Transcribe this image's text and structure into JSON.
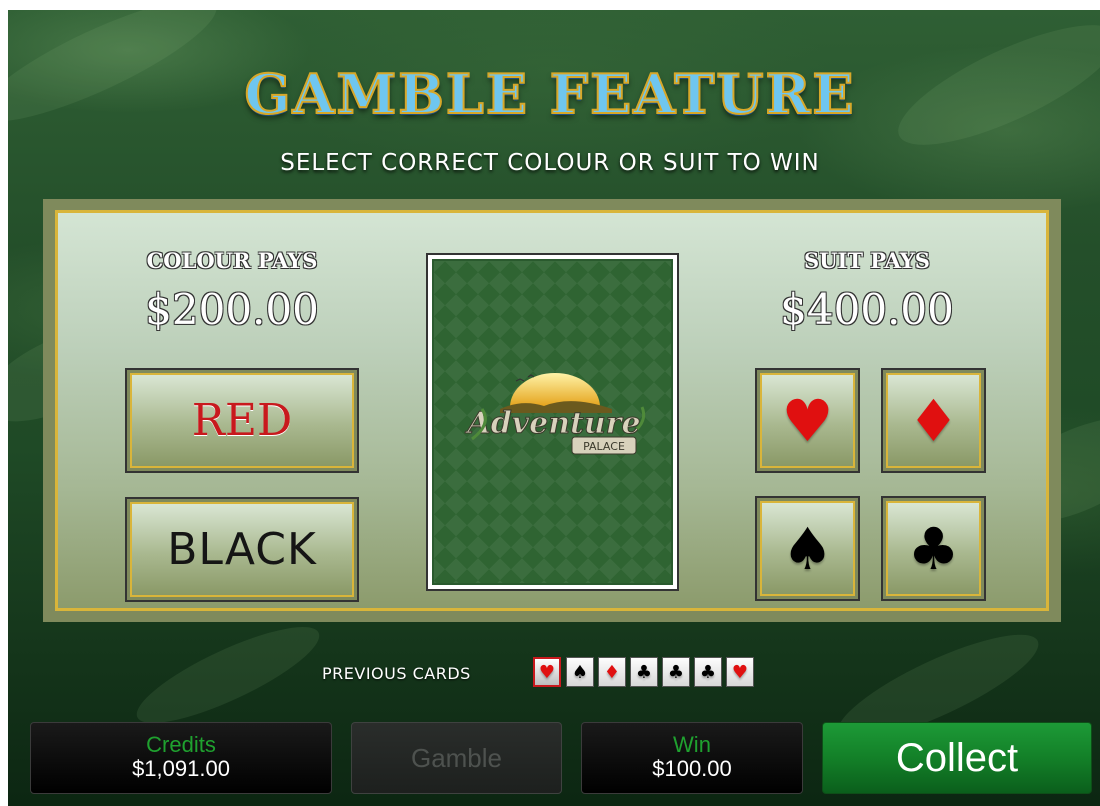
{
  "title": "GAMBLE FEATURE",
  "subtitle": "SELECT CORRECT COLOUR OR SUIT TO WIN",
  "colour_pays": {
    "label": "COLOUR PAYS",
    "value": "$200.00"
  },
  "suit_pays": {
    "label": "SUIT PAYS",
    "value": "$400.00"
  },
  "colour_buttons": {
    "red": "RED",
    "black": "BLACK"
  },
  "suit_buttons": [
    {
      "suit": "hearts",
      "glyph": "♥",
      "color": "#e01010"
    },
    {
      "suit": "diamonds",
      "glyph": "♦",
      "color": "#e01010"
    },
    {
      "suit": "spades",
      "glyph": "♠",
      "color": "#000000"
    },
    {
      "suit": "clubs",
      "glyph": "♣",
      "color": "#000000"
    }
  ],
  "card_back": {
    "logo_text_main": "Adventure",
    "logo_text_sub": "PALACE"
  },
  "previous_cards": {
    "label": "PREVIOUS CARDS",
    "cards": [
      {
        "suit": "hearts",
        "glyph": "♥",
        "color": "#e01010"
      },
      {
        "suit": "spades",
        "glyph": "♠",
        "color": "#000000"
      },
      {
        "suit": "diamonds",
        "glyph": "♦",
        "color": "#e01010"
      },
      {
        "suit": "clubs",
        "glyph": "♣",
        "color": "#000000"
      },
      {
        "suit": "clubs",
        "glyph": "♣",
        "color": "#000000"
      },
      {
        "suit": "clubs",
        "glyph": "♣",
        "color": "#000000"
      },
      {
        "suit": "hearts",
        "glyph": "♥",
        "color": "#e01010"
      }
    ]
  },
  "footer": {
    "credits_label": "Credits",
    "credits_value": "$1,091.00",
    "gamble_label": "Gamble",
    "win_label": "Win",
    "win_value": "$100.00",
    "collect_label": "Collect"
  },
  "colors": {
    "accent_gold": "#d9b53a",
    "title_blue": "#6fc6ef",
    "credits_green": "#1fa12f",
    "collect_green": "#138028",
    "red_suit": "#e01010"
  }
}
